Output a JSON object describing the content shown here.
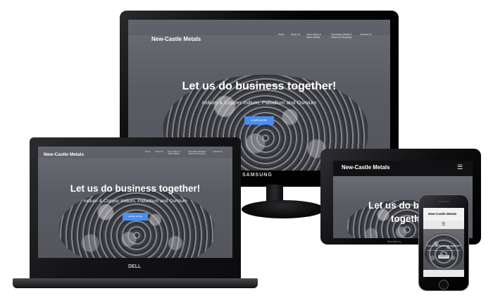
{
  "site": {
    "brand": "New-Castle Metals",
    "nav": [
      "Home",
      "About Us",
      "Ferro Alloys & Minor Metals",
      "Secondary Metals & Alloys for Recycling",
      "Contact Us"
    ],
    "hero_title": "Let us do business together!",
    "hero_subtitle": "Iridium & Copper Iridium, Palladium and Osmium",
    "cta_label": "LEARN MORE"
  },
  "tablet": {
    "hero_title_line1": "Let us do bus",
    "hero_title_line2": "together!",
    "brand_label": "BlackBerry"
  },
  "phone": {
    "hero_title": "Let us do business together!",
    "hero_subtitle": "Iridium & Copper Iridium, Palladium and Osmium"
  },
  "devices": {
    "monitor_brand": "SAMSUNG",
    "laptop_brand": "DELL"
  },
  "icons": {
    "menu": "hamburger-menu-icon"
  },
  "colors": {
    "accent": "#4a8ef0",
    "bezel": "#0c0c0e",
    "screen_overlay": "#5d5f66"
  }
}
